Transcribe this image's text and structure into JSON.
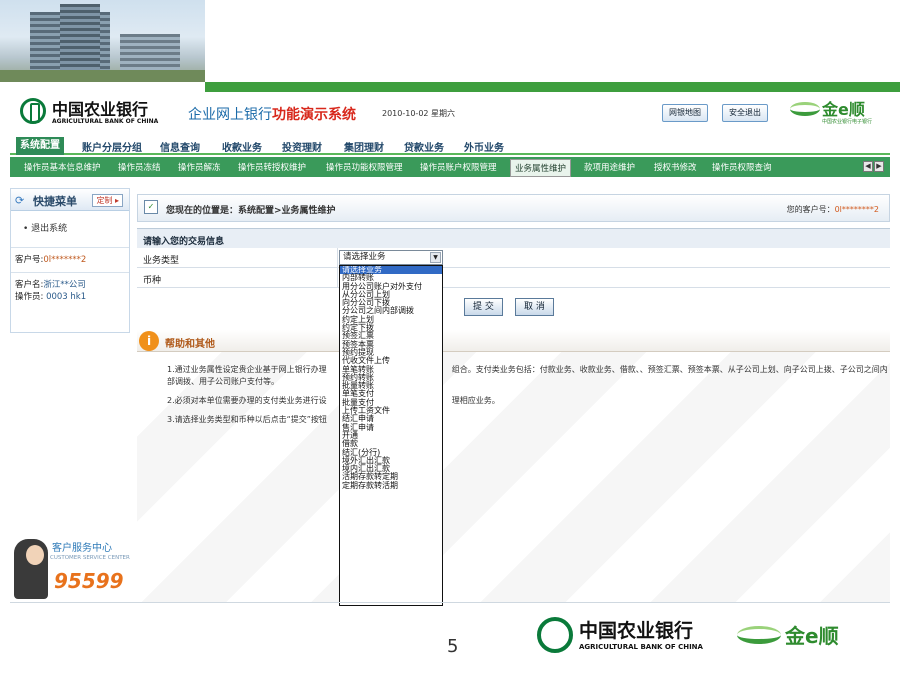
{
  "header": {
    "bank_cn": "中国农业银行",
    "bank_en": "AGRICULTURAL BANK OF CHINA",
    "system_title_prefix": "企业网上银行",
    "system_title_highlight": "功能演示系统",
    "date": "2010-10-02 星期六",
    "sitemap_button": "网银地图",
    "logout_button": "安全退出",
    "brand": "金e顺",
    "brand_sub": "中国农业银行电子银行"
  },
  "main_nav": {
    "tabs": [
      "系统配置",
      "账户分层分组",
      "信息查询",
      "收款业务",
      "投资理财",
      "集团理财",
      "贷款业务",
      "外币业务"
    ],
    "active": "系统配置"
  },
  "sub_nav": {
    "items": [
      "操作员基本信息维护",
      "操作员冻结",
      "操作员解冻",
      "操作员转授权维护",
      "操作员功能权限管理",
      "操作员账户权限管理",
      "业务属性维护",
      "款项用途维护",
      "授权书修改",
      "操作员权限查询"
    ],
    "active": "业务属性维护"
  },
  "left_panel": {
    "title": "快捷菜单",
    "customize_button": "定制",
    "menu_item": "退出系统",
    "customer_no_label": "客户号:",
    "customer_no_value": "0l*******2",
    "customer_name_label": "客户名:",
    "customer_name_value": "浙江**公司",
    "operator_label": "操作员:",
    "operator_value": "0003 hk1"
  },
  "customer_service": {
    "title": "客户服务中心",
    "subtitle": "CUSTOMER SERVICE CENTER",
    "number": "95599"
  },
  "location": {
    "text": "您现在的位置是：系统配置>业务属性维护",
    "customer_label": "您的客户号：",
    "customer_value": "0l********2"
  },
  "form": {
    "title": "请输入您的交易信息",
    "business_type_label": "业务类型",
    "currency_label": "币种",
    "select_value": "请选择业务",
    "submit_button": "提 交",
    "cancel_button": "取 消"
  },
  "dropdown_options": [
    "请选择业务",
    "内部转账",
    "用分公司账户对外支付",
    "从分公司上划",
    "向分公司下拨",
    "分公司之间内部调拨",
    "约定上划",
    "约定下拨",
    "预签汇票",
    "预签本票",
    "预约提现",
    "代收文件上传",
    "单笔转账",
    "预约转账",
    "批量转账",
    "单笔支付",
    "批量支付",
    "上传工资文件",
    "结汇申请",
    "售汇申请",
    "开通",
    "借款",
    "结汇(分行)",
    "境外汇出汇款",
    "境内汇出汇款",
    "活期存款转定期",
    "定期存款转活期"
  ],
  "help": {
    "title": "帮助和其他",
    "lines": [
      "1.通过业务属性设定贵企业基于网上银行办理 　　　　　　　　　　　　　　　 组合。支付类业务包括：付款业务、收款业务、借款、、预签汇票、预签本票、从子公司上划、向子公司上拨、子公司之间内部调拨、用子公司账户支付等。",
      "2.必须对本单位需要办理的支付类业务进行设 　　　　　　　　　　　　　　　 理相应业务。",
      "3.请选择业务类型和币种以后点击“提交”按钮"
    ]
  },
  "footer": {
    "page_number": "5",
    "bank_cn": "中国农业银行",
    "bank_en": "AGRICULTURAL BANK OF CHINA",
    "brand": "金e顺"
  }
}
